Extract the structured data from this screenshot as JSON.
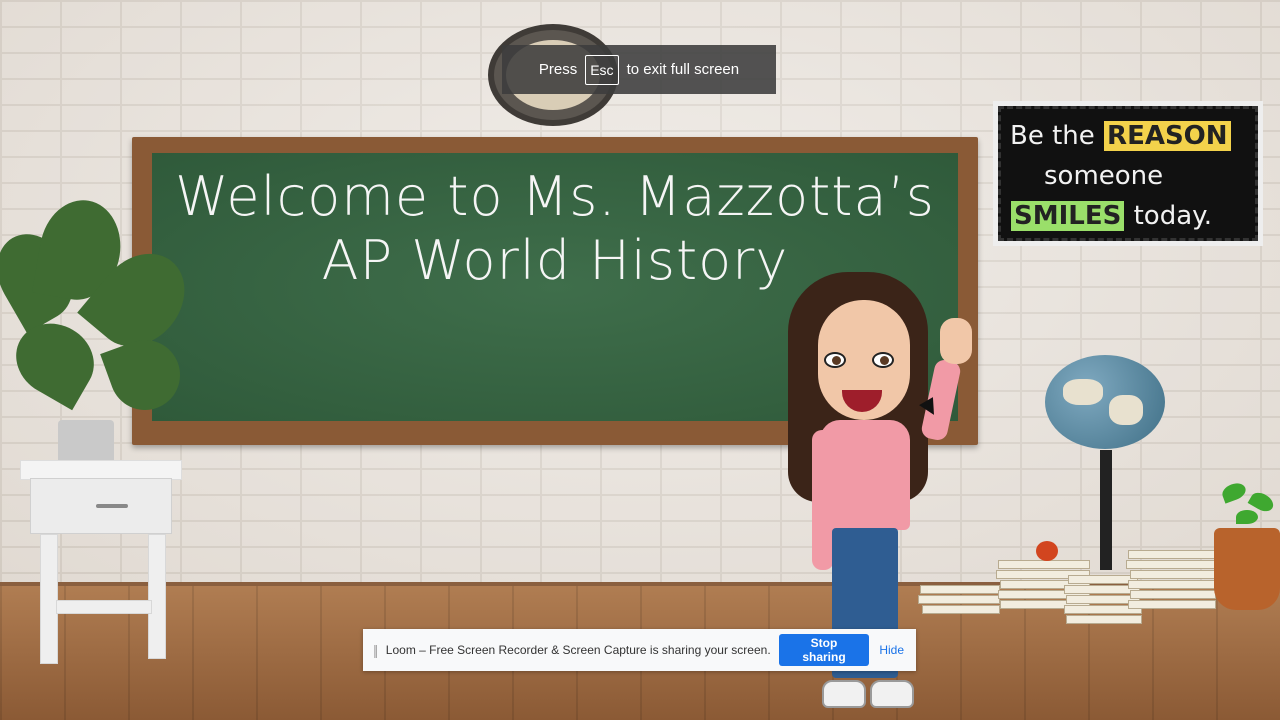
{
  "fullscreen_toast": {
    "prefix": "Press",
    "key": "Esc",
    "suffix": "to exit full screen"
  },
  "chalkboard": {
    "line1": "Welcome to Ms. Mazzotta’s",
    "line2": "AP World History"
  },
  "poster": {
    "words": [
      "Be the",
      "REASON",
      "someone",
      "SMILES",
      "today."
    ],
    "tile_colors": [
      "#f3d24b",
      "#ee6b8e",
      "#7fd0e8",
      "#9adf6a",
      "#f59b42",
      "#c49bf0"
    ]
  },
  "share_bar": {
    "grip_icon": "drag-handle-icon",
    "message": "Loom – Free Screen Recorder & Screen Capture is sharing your screen.",
    "stop_label": "Stop sharing",
    "hide_label": "Hide"
  },
  "colors": {
    "chalkboard": "#2f5a3a",
    "accent_blue": "#1a73e8",
    "toast_bg": "#3c3c3c"
  }
}
